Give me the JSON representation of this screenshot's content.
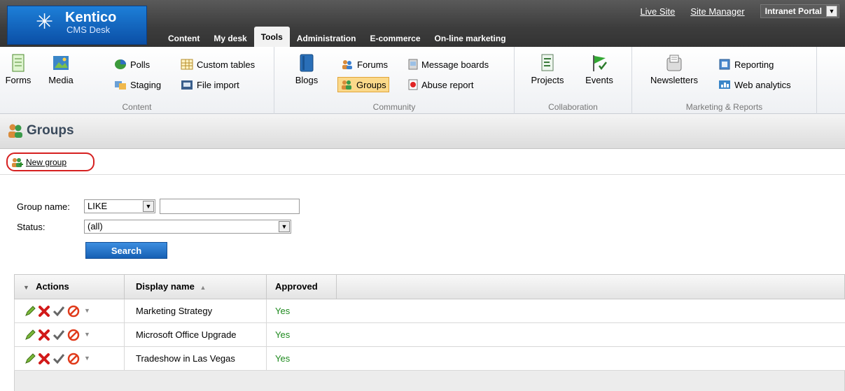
{
  "brand": {
    "title": "Kentico",
    "subtitle": "CMS Desk"
  },
  "toplinks": {
    "live_site": "Live Site",
    "site_manager": "Site Manager",
    "site_select": "Intranet Portal"
  },
  "tabs": [
    "Content",
    "My desk",
    "Tools",
    "Administration",
    "E-commerce",
    "On-line marketing"
  ],
  "active_tab": "Tools",
  "ribbon": {
    "content": {
      "label": "Content",
      "forms": "Forms",
      "media": "Media",
      "polls": "Polls",
      "staging": "Staging",
      "custom_tables": "Custom tables",
      "file_import": "File import"
    },
    "community": {
      "label": "Community",
      "blogs": "Blogs",
      "forums": "Forums",
      "groups": "Groups",
      "message_boards": "Message boards",
      "abuse_report": "Abuse report"
    },
    "collaboration": {
      "label": "Collaboration",
      "projects": "Projects",
      "events": "Events"
    },
    "marketing": {
      "label": "Marketing & Reports",
      "newsletters": "Newsletters",
      "reporting": "Reporting",
      "web_analytics": "Web analytics"
    }
  },
  "page": {
    "title": "Groups",
    "new_group": "New group"
  },
  "filter": {
    "group_name_label": "Group name:",
    "group_name_op": "LIKE",
    "group_name_value": "",
    "status_label": "Status:",
    "status_value": "(all)",
    "search_button": "Search"
  },
  "grid": {
    "headers": {
      "actions": "Actions",
      "display_name": "Display name",
      "approved": "Approved"
    },
    "rows": [
      {
        "name": "Marketing Strategy",
        "approved": "Yes"
      },
      {
        "name": "Microsoft Office Upgrade",
        "approved": "Yes"
      },
      {
        "name": "Tradeshow in Las Vegas",
        "approved": "Yes"
      }
    ]
  },
  "colors": {
    "accent": "#1660b4",
    "approved": "#1e8a1e",
    "highlight": "#d62020"
  }
}
